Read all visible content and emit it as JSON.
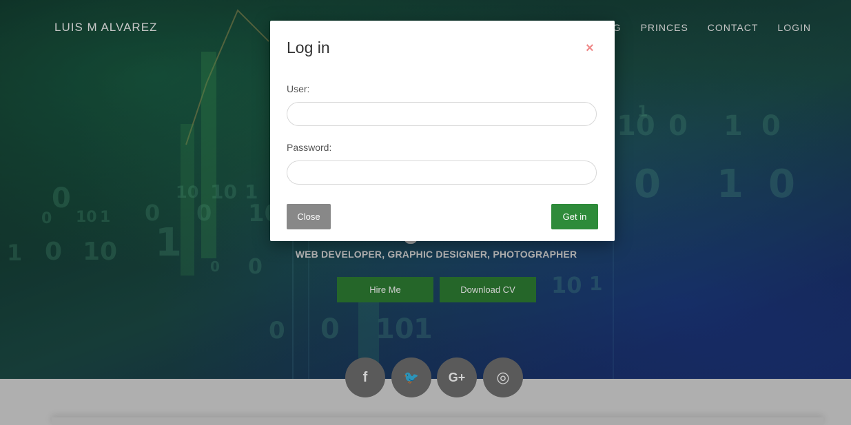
{
  "header": {
    "brand": "LUIS M ALVAREZ",
    "nav": [
      "BLOG",
      "PRINCES",
      "CONTACT",
      "LOGIN"
    ]
  },
  "hero": {
    "subtitle": "WEB DEVELOPER, GRAPHIC DESIGNER, PHOTOGRAPHER",
    "hire_label": "Hire Me",
    "download_label": "Download CV",
    "background_digits": [
      "0",
      "10",
      "10",
      "1",
      "0",
      "10",
      "1",
      "0",
      "0",
      "10",
      "1",
      "0",
      "10",
      "1",
      "0",
      "0",
      "10",
      "1",
      "0",
      "1",
      "0",
      "0",
      "1",
      "0",
      "10",
      "1",
      "0",
      "0",
      "10",
      "1"
    ]
  },
  "social": [
    {
      "icon": "facebook-icon",
      "glyph": "f"
    },
    {
      "icon": "twitter-icon",
      "glyph": "🐦"
    },
    {
      "icon": "google-plus-icon",
      "glyph": "G+"
    },
    {
      "icon": "instagram-icon",
      "glyph": "◎"
    }
  ],
  "modal": {
    "title": "Log in",
    "close_glyph": "×",
    "user_label": "User:",
    "user_value": "",
    "password_label": "Password:",
    "password_value": "",
    "close_label": "Close",
    "submit_label": "Get in"
  },
  "colors": {
    "accent_green": "#2e7d32",
    "close_x": "#ef8a8a",
    "social_bg": "#6e6e6e"
  }
}
